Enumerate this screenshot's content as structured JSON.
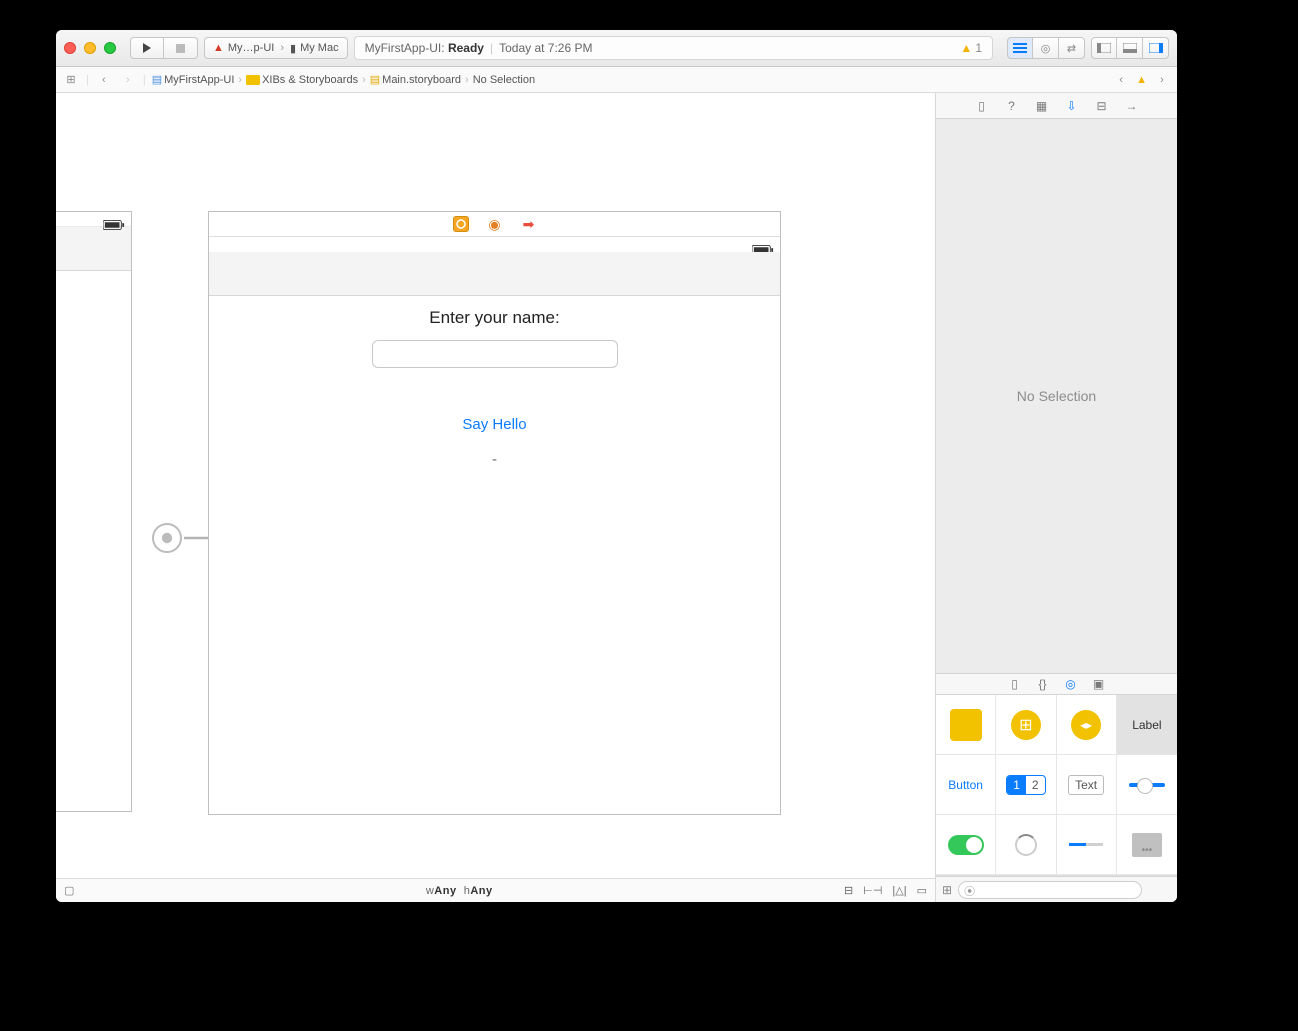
{
  "toolbar": {
    "scheme_app": "My…p-UI",
    "scheme_device": "My Mac",
    "status_app": "MyFirstApp-UI:",
    "status_state": "Ready",
    "status_time": "Today at 7:26 PM",
    "warning_count": "1"
  },
  "jumpbar": {
    "crumb1": "MyFirstApp-UI",
    "crumb2": "XIBs & Storyboards",
    "crumb3": "Main.storyboard",
    "crumb4": "No Selection"
  },
  "canvas": {
    "label_name": "Enter your name:",
    "button_hello": "Say Hello",
    "output": "-"
  },
  "sizeclass": {
    "w_prefix": "w",
    "w_value": "Any",
    "h_prefix": "h",
    "h_value": "Any"
  },
  "inspector": {
    "empty": "No Selection"
  },
  "library": {
    "label": "Label",
    "button": "Button",
    "seg1": "1",
    "seg2": "2",
    "text": "Text",
    "filter_placeholder": ""
  }
}
